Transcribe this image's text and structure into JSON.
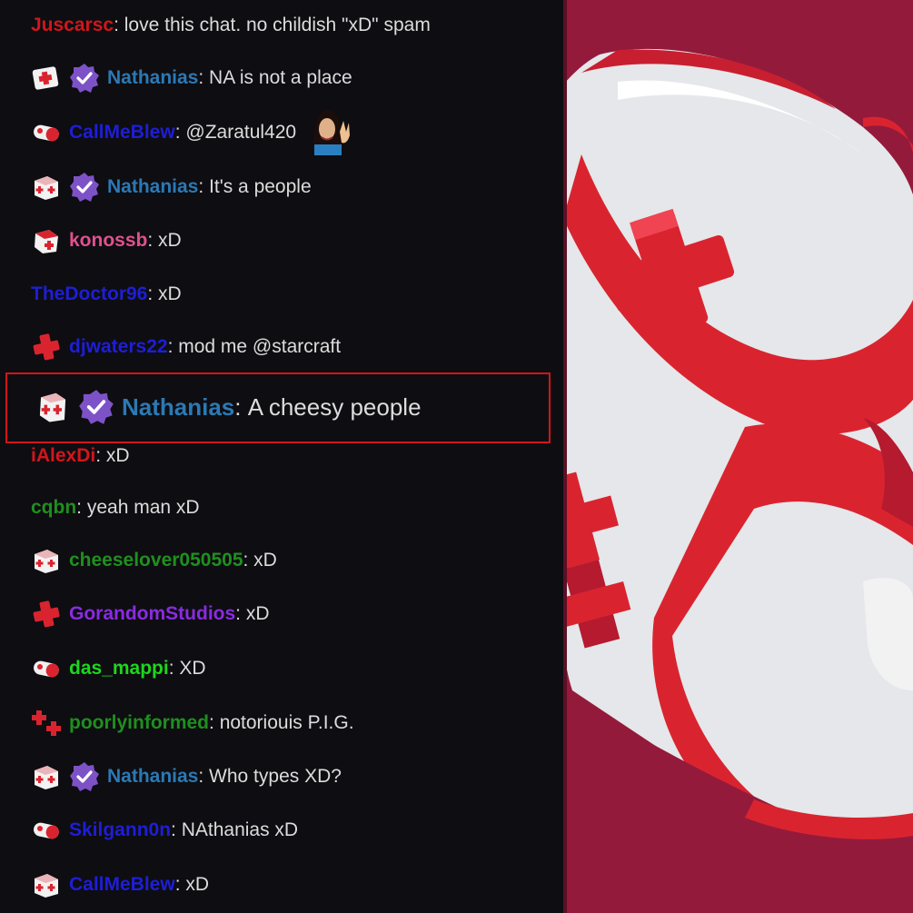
{
  "colors": {
    "chat_bg": "#0e0d11",
    "message_text": "#dcdcdc",
    "highlight_border": "#d1161c",
    "verified_badge": "#7d52c7",
    "art_bg": "#941a3b"
  },
  "badges": {
    "kit": "medkit-badge-icon",
    "box": "medbox-badge-icon",
    "pill": "pill-badge-icon",
    "cross": "red-cross-badge-icon",
    "double": "double-cross-badge-icon",
    "verified": "verified-check-badge-icon"
  },
  "messages": [
    {
      "user": "Juscarsc",
      "color": "#d1161c",
      "text": "love this chat. no childish \"xD\" spam"
    },
    {
      "user": "Nathanias",
      "color": "#2b79b5",
      "text": "NA is not a place"
    },
    {
      "user": "CallMeBlew",
      "color": "#1e1ed6",
      "text": "@Zaratul420",
      "emote": "waving-woman-emote"
    },
    {
      "user": "Nathanias",
      "color": "#2b79b5",
      "text": "It's a people"
    },
    {
      "user": "konossb",
      "color": "#e0508f",
      "text": "xD"
    },
    {
      "user": "TheDoctor96",
      "color": "#1e1ed6",
      "text": "xD"
    },
    {
      "user": "djwaters22",
      "color": "#1e1ed6",
      "text": "mod me @starcraft"
    },
    {
      "user": "Nathanias",
      "color": "#2b79b5",
      "text": "A cheesy people"
    },
    {
      "user": "iAlexDi",
      "color": "#d1161c",
      "text": "xD"
    },
    {
      "user": "cqbn",
      "color": "#1f8f1f",
      "text": "yeah man xD"
    },
    {
      "user": "cheeselover050505",
      "color": "#1f8f1f",
      "text": "xD"
    },
    {
      "user": "GorandomStudios",
      "color": "#8a2be2",
      "text": "xD"
    },
    {
      "user": "das_mappi",
      "color": "#1ed61e",
      "text": "XD"
    },
    {
      "user": "poorlyinformed",
      "color": "#1f8f1f",
      "text": "notoriouis P.I.G."
    },
    {
      "user": "Nathanias",
      "color": "#2b79b5",
      "text": "Who types XD?"
    },
    {
      "user": "Skilgann0n",
      "color": "#1e1ed6",
      "text": "NAthanias xD"
    },
    {
      "user": "CallMeBlew",
      "color": "#1e1ed6",
      "text": "xD"
    }
  ]
}
